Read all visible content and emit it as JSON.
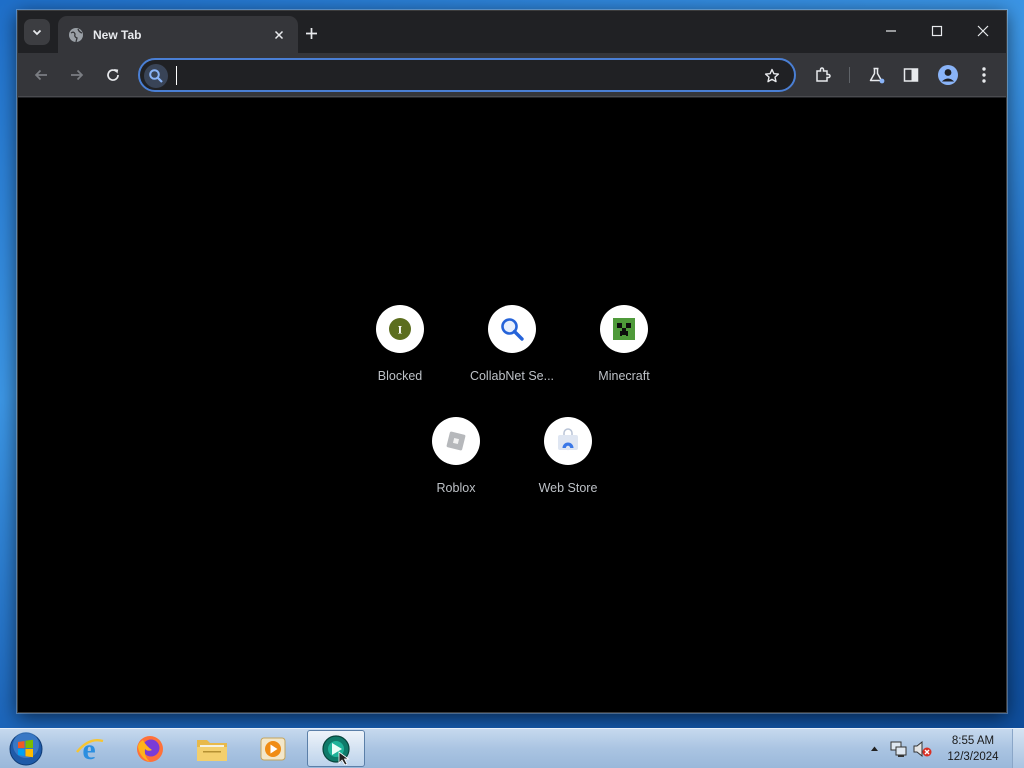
{
  "browser": {
    "tab": {
      "title": "New Tab"
    },
    "omnibox": {
      "value": "",
      "placeholder": ""
    },
    "colors": {
      "frame": "#202124",
      "toolbar": "#35363a",
      "omnibox_border": "#4a7fd4",
      "content_bg": "#000000"
    }
  },
  "shortcuts": [
    {
      "label": "Blocked",
      "icon": "blocked-favicon"
    },
    {
      "label": "CollabNet Se...",
      "icon": "magnifier-favicon"
    },
    {
      "label": "Minecraft",
      "icon": "creeper-favicon"
    },
    {
      "label": "Roblox",
      "icon": "roblox-favicon"
    },
    {
      "label": "Web Store",
      "icon": "webstore-favicon"
    }
  ],
  "taskbar": {
    "apps": [
      "internet-explorer",
      "firefox",
      "file-explorer",
      "media-player",
      "browser-active"
    ],
    "clock": {
      "time": "8:55 AM",
      "date": "12/3/2024"
    }
  }
}
